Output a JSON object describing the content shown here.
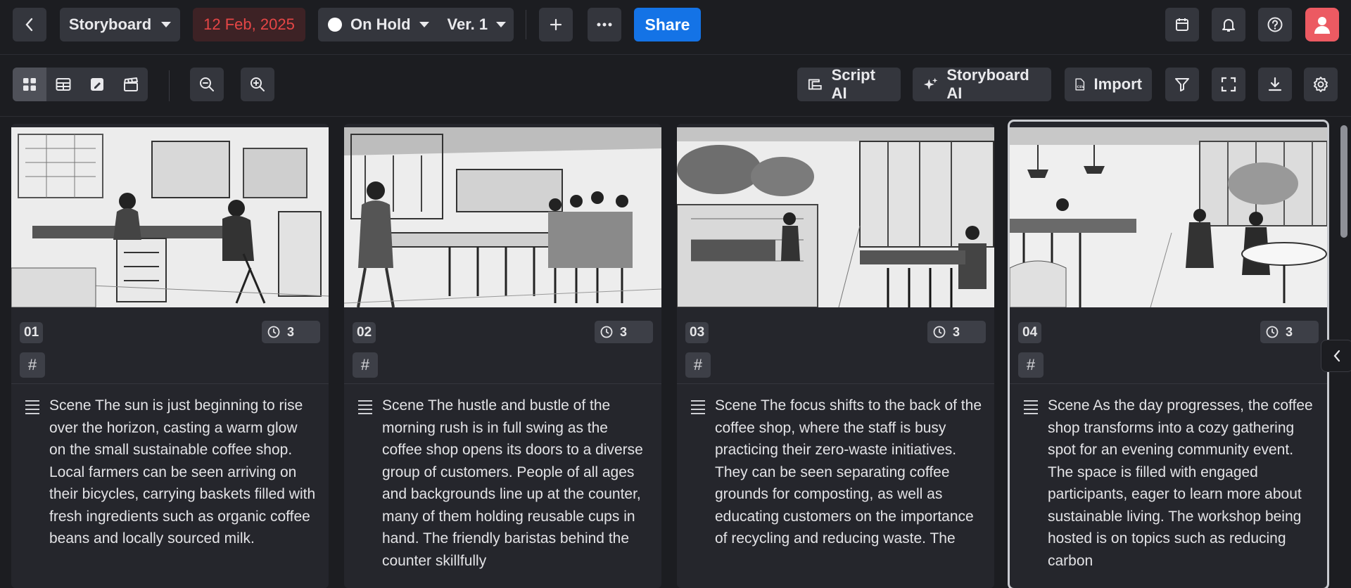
{
  "header": {
    "project_label": "Storyboard",
    "date": "12 Feb, 2025",
    "status": "On Hold",
    "version": "Ver. 1",
    "share_label": "Share"
  },
  "toolbar": {
    "script_ai": "Script AI",
    "storyboard_ai": "Storyboard AI",
    "import": "Import"
  },
  "scenes": [
    {
      "number": "01",
      "duration": "3",
      "tag": "#",
      "description": "Scene The sun is just beginning to rise over the horizon, casting a warm glow on the small sustainable coffee shop. Local farmers can be seen arriving on their bicycles, carrying baskets filled with fresh ingredients such as organic coffee beans and locally sourced milk."
    },
    {
      "number": "02",
      "duration": "3",
      "tag": "#",
      "description": "Scene The hustle and bustle of the morning rush is in full swing as the coffee shop opens its doors to a diverse group of customers. People of all ages and backgrounds line up at the counter, many of them holding reusable cups in hand. The friendly baristas behind the counter skillfully"
    },
    {
      "number": "03",
      "duration": "3",
      "tag": "#",
      "description": "Scene The focus shifts to the back of the coffee shop, where the staff is busy practicing their zero-waste initiatives. They can be seen separating coffee grounds for composting, as well as educating customers on the importance of recycling and reducing waste. The"
    },
    {
      "number": "04",
      "duration": "3",
      "tag": "#",
      "description": "Scene As the day progresses, the coffee shop transforms into a cozy gathering spot for an evening community event. The space is filled with engaged participants, eager to learn more about sustainable living. The workshop being hosted is on topics such as reducing carbon"
    }
  ],
  "colors": {
    "background": "#1c1d21",
    "card": "#25262c",
    "accent_blue": "#1473e6",
    "date_red": "#e64646",
    "avatar": "#ec5a62"
  }
}
